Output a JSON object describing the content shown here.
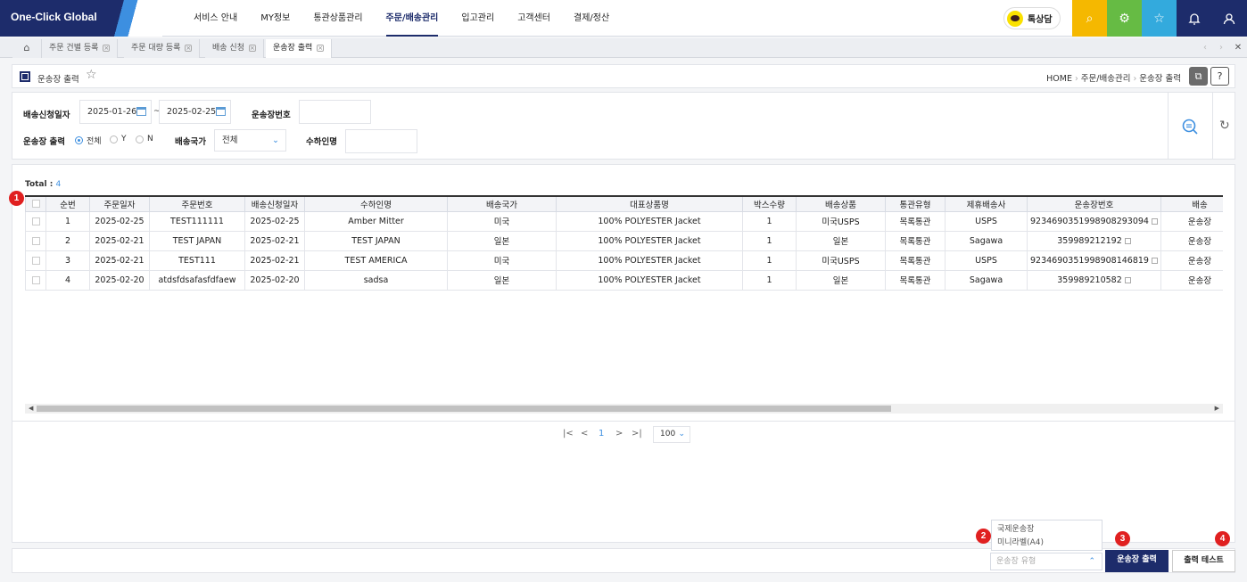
{
  "app": {
    "logo": "One-Click Global"
  },
  "menu": [
    "서비스 안내",
    "MY정보",
    "통관상품관리",
    "주문/배송관리",
    "입고관리",
    "고객센터",
    "결제/정산"
  ],
  "kakao": {
    "label": "톡상담"
  },
  "top_icons": [
    {
      "name": "search-icon",
      "glyph": "⚲",
      "color": "#f5b800"
    },
    {
      "name": "settings-icon",
      "glyph": "⚙",
      "color": "#66bb44"
    },
    {
      "name": "star-icon",
      "glyph": "☆",
      "color": "#33aadd"
    },
    {
      "name": "bell-icon",
      "glyph": "♫",
      "color": "#1d2c6b"
    },
    {
      "name": "user-icon",
      "glyph": "⚇",
      "color": "#1d2c6b"
    }
  ],
  "tabs": [
    {
      "label": "주문 건별 등록"
    },
    {
      "label": "주문 대량 등록"
    },
    {
      "label": "배송 신청"
    },
    {
      "label": "운송장 출력"
    }
  ],
  "page": {
    "title": "운송장 출력",
    "breadcrumb": [
      "HOME",
      "주문/배송관리",
      "운송장 출력"
    ]
  },
  "search": {
    "date_label": "배송신청일자",
    "date_from": "2025-01-26",
    "date_sep": "~",
    "date_to": "2025-02-25",
    "waybill_label": "운송장번호",
    "waybill_value": "",
    "print_label": "운송장 출력",
    "radio": [
      "전체",
      "Y",
      "N"
    ],
    "country_label": "배송국가",
    "country_value": "전체",
    "recipient_label": "수하인명",
    "recipient_value": ""
  },
  "grid": {
    "total_label": "Total :",
    "total": "4",
    "columns": [
      "순번",
      "주문일자",
      "주문번호",
      "배송신청일자",
      "수하인명",
      "배송국가",
      "대표상품명",
      "박스수량",
      "배송상품",
      "통관유형",
      "제휴배송사",
      "운송장번호",
      "배송"
    ],
    "rows": [
      [
        "1",
        "2025-02-25",
        "TEST111111",
        "2025-02-25",
        "Amber Mitter",
        "미국",
        "100% POLYESTER Jacket",
        "1",
        "미국USPS",
        "목록통관",
        "USPS",
        "9234690351998908293094",
        "운송장"
      ],
      [
        "2",
        "2025-02-21",
        "TEST JAPAN",
        "2025-02-21",
        "TEST JAPAN",
        "일본",
        "100% POLYESTER Jacket",
        "1",
        "일본",
        "목록통관",
        "Sagawa",
        "359989212192",
        "운송장"
      ],
      [
        "3",
        "2025-02-21",
        "TEST111",
        "2025-02-21",
        "TEST AMERICA",
        "미국",
        "100% POLYESTER Jacket",
        "1",
        "미국USPS",
        "목록통관",
        "USPS",
        "9234690351998908146819",
        "운송장"
      ],
      [
        "4",
        "2025-02-20",
        "atdsfdsafasfdfaew",
        "2025-02-20",
        "sadsa",
        "일본",
        "100% POLYESTER Jacket",
        "1",
        "일본",
        "목록통관",
        "Sagawa",
        "359989210582",
        "운송장"
      ]
    ]
  },
  "pager": {
    "current": "1",
    "page_size": "100"
  },
  "bottom": {
    "dropdown_options": [
      "국제운송장",
      "미니라벨(A4)"
    ],
    "select_placeholder": "운송장 유형",
    "print_btn": "운송장 출력",
    "test_btn": "출력 테스트"
  },
  "badges": [
    "1",
    "2",
    "3",
    "4"
  ]
}
